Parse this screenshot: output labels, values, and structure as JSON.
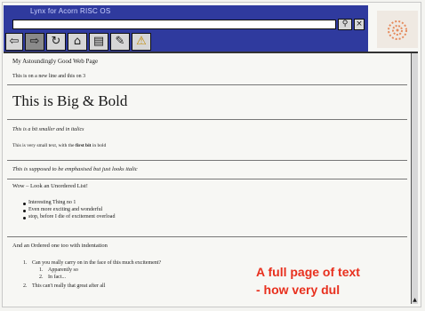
{
  "window": {
    "title": "Lynx for Acorn RISC OS"
  },
  "address_bar": {
    "value": ""
  },
  "toolbar": {
    "buttons": [
      {
        "name": "back-button",
        "glyph": "⇦"
      },
      {
        "name": "forward-button",
        "glyph": "⇨"
      },
      {
        "name": "reload-button",
        "glyph": "↻"
      },
      {
        "name": "home-button",
        "glyph": "⌂"
      },
      {
        "name": "save-button",
        "glyph": "▤"
      },
      {
        "name": "edit-button",
        "glyph": "✎"
      },
      {
        "name": "warning-button",
        "glyph": "⚠"
      }
    ],
    "search_glyph": "⚲",
    "stop_glyph": "×"
  },
  "page": {
    "heading": "My Astoundingly Good Web Page",
    "line1": "This is on a new line and this on 3",
    "big_bold": "This is Big & Bold",
    "smaller_italic": "This is a bit smaller and in italics",
    "small_text_pre": "This is very small text, with the",
    "small_text_bold": "first bit",
    "small_text_post": "in bold",
    "emphasised": "This is supposed to be emphasised but just looks italic",
    "wow_line": "Wow – Look an Unordered List!",
    "unordered_list": [
      "Interesting Thing no 1",
      "Even more exciting and wonderful",
      "stop, before I die of excitement overload"
    ],
    "ordered_intro": "And an Ordered one too with indentation",
    "ordered_list": [
      {
        "num": "1.",
        "text": "Can you really carry on in the face of this much excitement?"
      },
      {
        "num": "1.",
        "text": "Apparently so",
        "sub": true
      },
      {
        "num": "2.",
        "text": "In fact...",
        "sub": true
      },
      {
        "num": "2.",
        "text": "This can't really that great after all"
      }
    ]
  },
  "caption": {
    "line1": "A full page of text",
    "line2": "- how very dul"
  },
  "colors": {
    "titlebar": "#2f3a9e",
    "caption": "#e8301e"
  }
}
